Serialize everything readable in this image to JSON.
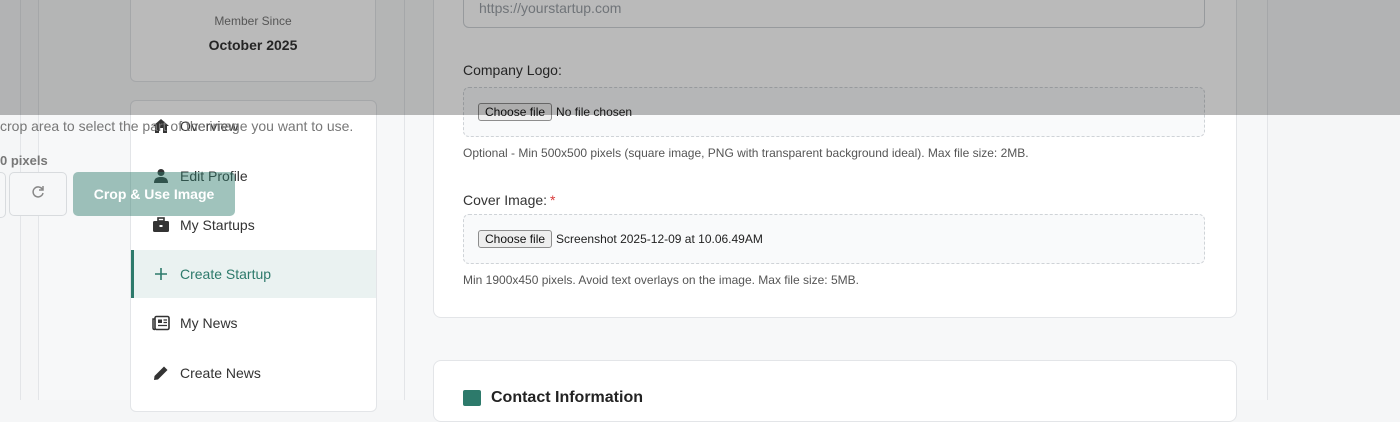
{
  "sidebar": {
    "member_label": "Member Since",
    "member_value": "October 2025",
    "items": [
      {
        "label": "Overview",
        "icon": "home-icon"
      },
      {
        "label": "Edit Profile",
        "icon": "user-icon"
      },
      {
        "label": "My Startups",
        "icon": "briefcase-icon"
      },
      {
        "label": "Create Startup",
        "icon": "plus-icon",
        "active": true
      },
      {
        "label": "My News",
        "icon": "newspaper-icon"
      },
      {
        "label": "Create News",
        "icon": "pencil-icon"
      }
    ]
  },
  "form": {
    "website_placeholder": "https://yourstartup.com",
    "logo_label": "Company Logo:",
    "logo_button": "Choose file",
    "logo_status": "No file chosen",
    "logo_help": "Optional - Min 500x500 pixels (square image, PNG with transparent background ideal). Max file size: 2MB.",
    "cover_label": "Cover Image:",
    "cover_required": "*",
    "cover_button": "Choose file",
    "cover_status": "Screenshot 2025-12-09 at 10.06.49AM",
    "cover_help": "Min 1900x450 pixels. Avoid text overlays on the image. Max file size: 5MB."
  },
  "contact": {
    "title": "Contact Information",
    "icon": "contact-card-icon"
  },
  "crop_modal": {
    "instruction": "crop area to select the part of the image you want to use.",
    "size_text": "0 pixels",
    "rotate_icon": "rotate-icon",
    "crop_button": "Crop & Use Image"
  },
  "colors": {
    "accent": "#2d7a6b",
    "required": "#d93a3a",
    "active_bg": "#eaf2f1"
  }
}
